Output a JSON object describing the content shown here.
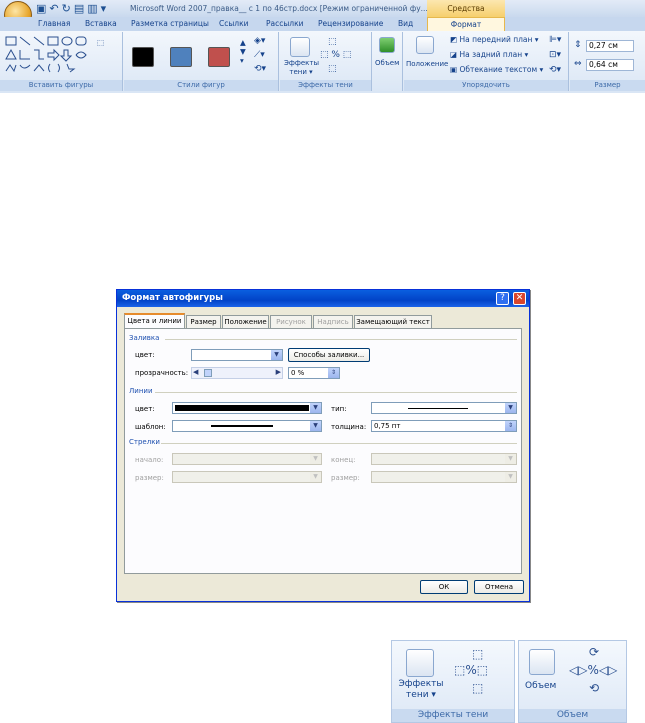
{
  "window": {
    "doc_title": "Microsoft Word 2007_правка__ с 1 по 46стр.docx [Режим ограниченной фу...",
    "context_tab": "Средства рисования"
  },
  "tabs": [
    "Главная",
    "Вставка",
    "Разметка страницы",
    "Ссылки",
    "Рассылки",
    "Рецензирование",
    "Вид"
  ],
  "active_tab": "Формат",
  "ribbon": {
    "groups": {
      "insert_shapes": "Вставить фигуры",
      "shape_styles": "Стили фигур",
      "shadow_effects": "Эффекты тени",
      "arrange": "Упорядочить",
      "size": "Размер"
    },
    "style_swatches": [
      "#000000",
      "#4f81bd",
      "#c0504d"
    ],
    "shadow_button": "Эффекты тени ▾",
    "volume_button": "Объем",
    "position_button": "Положение",
    "bring_front": "На передний план ▾",
    "send_back": "На задний план ▾",
    "text_wrap": "Обтекание текстом ▾",
    "height": "0,27 см",
    "width": "0,64 см"
  },
  "dialog": {
    "title": "Формат автофигуры",
    "help": "?",
    "close": "✕",
    "tabs": [
      {
        "label": "Цвета и линии",
        "state": "active"
      },
      {
        "label": "Размер",
        "state": "normal"
      },
      {
        "label": "Положение",
        "state": "normal"
      },
      {
        "label": "Рисунок",
        "state": "disabled"
      },
      {
        "label": "Надпись",
        "state": "disabled"
      },
      {
        "label": "Замещающий текст",
        "state": "normal"
      }
    ],
    "fill": {
      "section": "Заливка",
      "color_label": "цвет:",
      "fill_methods_btn": "Способы заливки...",
      "transparency_label": "прозрачность:",
      "transparency_value": "0 %"
    },
    "lines": {
      "section": "Линии",
      "color_label": "цвет:",
      "type_label": "тип:",
      "pattern_label": "шаблон:",
      "weight_label": "толщина:",
      "weight_value": "0,75 пт",
      "line_color": "#000000"
    },
    "arrows": {
      "section": "Стрелки",
      "begin_label": "начало:",
      "end_label": "конец:",
      "size_label1": "размер:",
      "size_label2": "размер:"
    },
    "ok": "ОК",
    "cancel": "Отмена"
  },
  "bottom": {
    "shadow": {
      "button": "Эффекты тени ▾",
      "group": "Эффекты тени"
    },
    "volume": {
      "button": "Объем",
      "group": "Объем"
    }
  }
}
